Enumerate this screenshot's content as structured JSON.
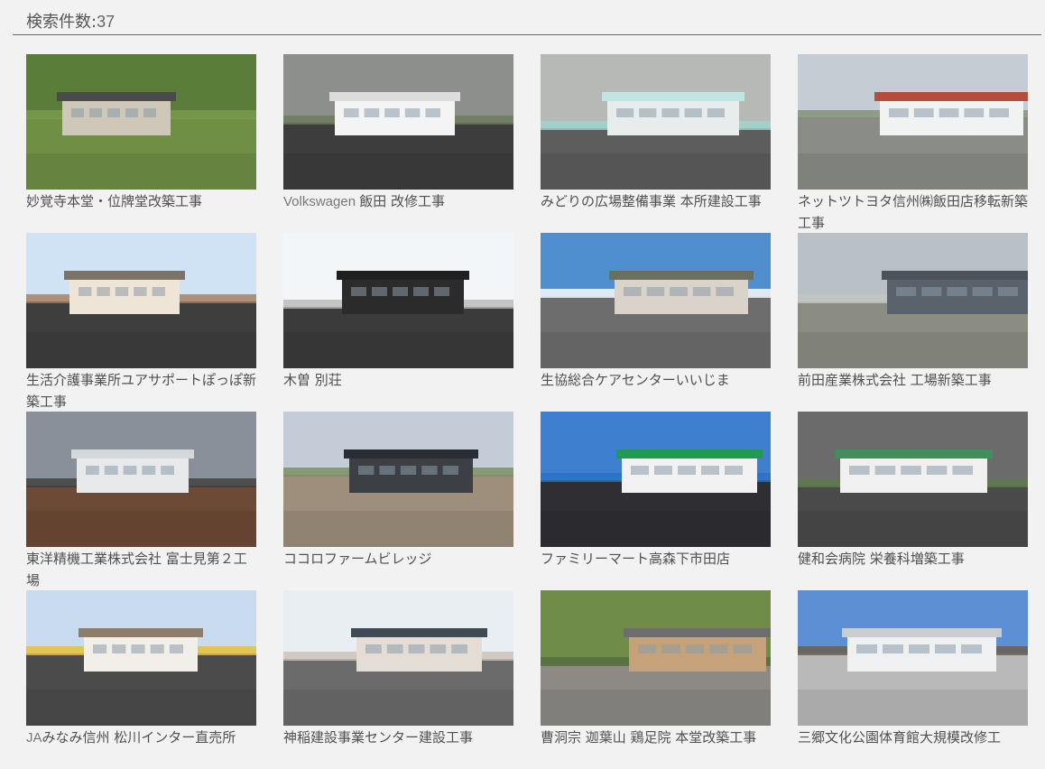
{
  "search": {
    "label": "検索件数:",
    "count": "37"
  },
  "projects": [
    {
      "title": "妙覚寺本堂・位牌堂改築工事",
      "thumb": {
        "sky": "#5b7d3a",
        "ground": "#6f8f45",
        "building": "#cfc7b8",
        "roof": "#4a4a4a",
        "accent": "#7a9c4d"
      }
    },
    {
      "title_latin": "Volkswagen",
      "title": "飯田 改修工事",
      "thumb": {
        "sky": "#8c8f8c",
        "ground": "#3d3d3d",
        "building": "#f4f4f4",
        "roof": "#dcdcdc",
        "accent": "#6b7a5c"
      }
    },
    {
      "title": "みどりの広場整備事業 本所建設工事",
      "thumb": {
        "sky": "#b7b9b6",
        "ground": "#5d5d5d",
        "building": "#e9ecec",
        "roof": "#bfe6e3",
        "accent": "#9dd7d0"
      }
    },
    {
      "title": "ネットツトヨタ信州㈱飯田店移転新築工事",
      "thumb": {
        "sky": "#c6ccd4",
        "ground": "#8a8d87",
        "building": "#f1f2f2",
        "roof": "#b44d3b",
        "accent": "#7f8e74"
      }
    },
    {
      "title": "生活介護事業所ユアサポートぽっぽ新築工事",
      "thumb": {
        "sky": "#cfe3f4",
        "ground": "#3e3e3e",
        "building": "#efe5d6",
        "roof": "#7d7267",
        "accent": "#a47a5e"
      }
    },
    {
      "title": "木曽 別荘",
      "thumb": {
        "sky": "#f3f6f8",
        "ground": "#3b3b3b",
        "building": "#2b2b2b",
        "roof": "#1f1f1f",
        "accent": "#b8b8b4"
      }
    },
    {
      "title": "生協総合ケアセンターいいじま",
      "thumb": {
        "sky": "#4f8fd0",
        "ground": "#6d6d6d",
        "building": "#d9d3c9",
        "roof": "#6a6f5f",
        "accent": "#ffffff"
      }
    },
    {
      "title": "前田産業株式会社 工場新築工事",
      "thumb": {
        "sky": "#b9c0c6",
        "ground": "#8b8d83",
        "building": "#59626a",
        "roof": "#4b5259",
        "accent": "#c3c6c0"
      }
    },
    {
      "title": "東洋精機工業株式会社 富士見第２工場",
      "thumb": {
        "sky": "#8a9099",
        "ground": "#6d4a36",
        "building": "#e7e9ea",
        "roof": "#d5d8da",
        "accent": "#3d3d3d"
      }
    },
    {
      "title": "ココロファームビレッジ",
      "thumb": {
        "sky": "#c3ccd7",
        "ground": "#9d8f7b",
        "building": "#3c3f44",
        "roof": "#2a2d31",
        "accent": "#7a8c5e"
      }
    },
    {
      "title": "ファミリーマート高森下市田店",
      "thumb": {
        "sky": "#3f7fd0",
        "ground": "#2f2f33",
        "building": "#f2f2f2",
        "roof": "#1f9a53",
        "accent": "#2b71c4"
      }
    },
    {
      "title": "健和会病院 栄養科増築工事",
      "thumb": {
        "sky": "#6b6b6b",
        "ground": "#4a4a4a",
        "building": "#f0f0f0",
        "roof": "#3f8f5a",
        "accent": "#5f7a4b"
      }
    },
    {
      "title_latin": "JA",
      "title": "みなみ信州 松川インター直売所",
      "thumb": {
        "sky": "#c9dbee",
        "ground": "#4b4b4b",
        "building": "#f2efe9",
        "roof": "#8e7d6a",
        "accent": "#e7c02d"
      }
    },
    {
      "title": "神稲建設事業センター建設工事",
      "thumb": {
        "sky": "#e9eef3",
        "ground": "#6b6b6b",
        "building": "#e4ddd6",
        "roof": "#3f4a54",
        "accent": "#c8c0b6"
      }
    },
    {
      "title": "曹洞宗 迦葉山 鶏足院 本堂改築工事",
      "thumb": {
        "sky": "#6f8c49",
        "ground": "#8d8a86",
        "building": "#c5a27a",
        "roof": "#6e6e6e",
        "accent": "#556b3c"
      }
    },
    {
      "title": "三郷文化公園体育館大規模改修工",
      "thumb": {
        "sky": "#5c8fd3",
        "ground": "#b9b9b9",
        "building": "#eef0f2",
        "roof": "#c9ccd0",
        "accent": "#6b5a4a"
      }
    }
  ]
}
